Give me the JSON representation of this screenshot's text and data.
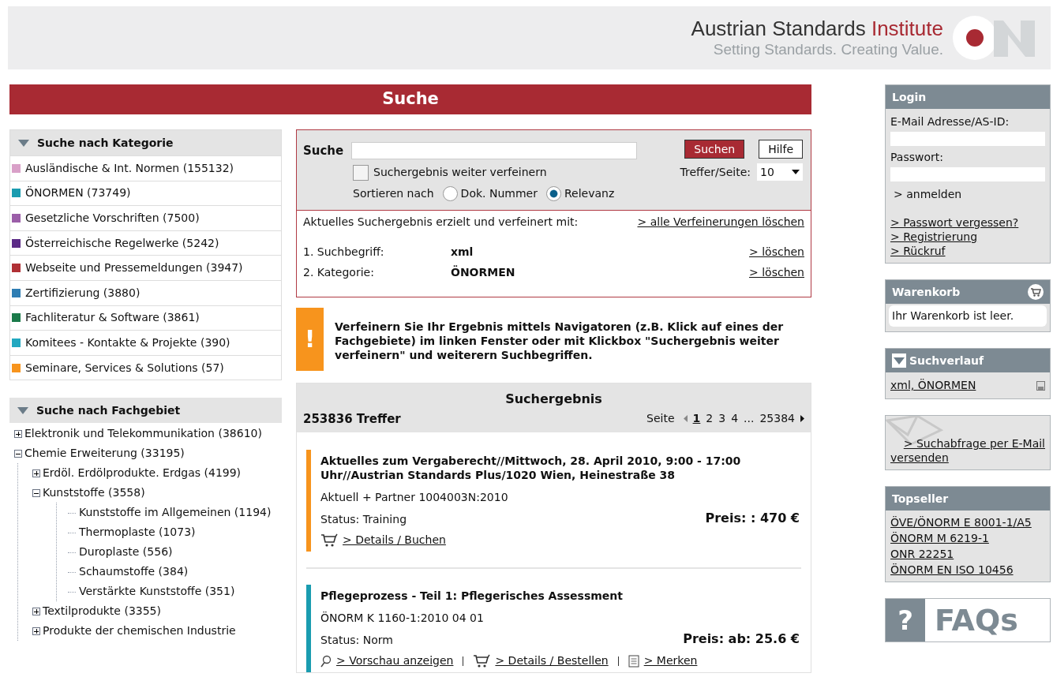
{
  "header": {
    "brand": "Austrian Standards",
    "brand_accent": "Institute",
    "tagline": "Setting Standards. Creating Value."
  },
  "page_title": "Suche",
  "categories": {
    "title": "Suche nach Kategorie",
    "items": [
      {
        "label": "Ausländische & Int. Normen (155132)",
        "color": "#d9a0c8"
      },
      {
        "label": "ÖNORMEN (73749)",
        "color": "#1a9cb0"
      },
      {
        "label": "Gesetzliche Vorschriften (7500)",
        "color": "#9b5ea8"
      },
      {
        "label": "Österreichische Regelwerke (5242)",
        "color": "#5b2a86"
      },
      {
        "label": "Webseite und Pressemeldungen (3947)",
        "color": "#b03035"
      },
      {
        "label": "Zertifizierung (3880)",
        "color": "#2e7db3"
      },
      {
        "label": "Fachliteratur & Software (3861)",
        "color": "#1a7a4a"
      },
      {
        "label": "Komitees - Kontakte & Projekte (390)",
        "color": "#22a8c0"
      },
      {
        "label": "Seminare, Services & Solutions (57)",
        "color": "#f7941d"
      }
    ]
  },
  "subjects": {
    "title": "Suche nach Fachgebiet",
    "tree": [
      {
        "label": "Elektronik und Telekommunikation (38610)",
        "kind": "branch",
        "expanded": false
      },
      {
        "label": "Chemie Erweiterung (33195)",
        "kind": "branch",
        "expanded": true,
        "children": [
          {
            "label": "Erdöl. Erdölprodukte. Erdgas (4199)",
            "kind": "branch",
            "expanded": false
          },
          {
            "label": "Kunststoffe (3558)",
            "kind": "branch",
            "expanded": true,
            "children": [
              {
                "label": "Kunststoffe im Allgemeinen (1194)",
                "kind": "leaf"
              },
              {
                "label": "Thermoplaste (1073)",
                "kind": "leaf"
              },
              {
                "label": "Duroplaste (556)",
                "kind": "leaf"
              },
              {
                "label": "Schaumstoffe (384)",
                "kind": "leaf"
              },
              {
                "label": "Verstärkte Kunststoffe (351)",
                "kind": "leaf"
              }
            ]
          },
          {
            "label": "Textilprodukte (3355)",
            "kind": "branch",
            "expanded": false
          },
          {
            "label": "Produkte der chemischen Industrie",
            "kind": "branch",
            "expanded": false
          }
        ]
      }
    ]
  },
  "search": {
    "label": "Suche",
    "search_button": "Suchen",
    "help_button": "Hilfe",
    "refine": {
      "label": "Suchergebnis weiter verfeinern",
      "checked": false
    },
    "per_page_label": "Treffer/Seite:",
    "per_page_value": "10",
    "sort_label": "Sortieren nach",
    "sort_options": [
      {
        "label": "Dok. Nummer",
        "selected": false
      },
      {
        "label": "Relevanz",
        "selected": true
      }
    ]
  },
  "refinements": {
    "intro": "Aktuelles Suchergebnis erzielt und verfeinert mit:",
    "clear_all": "> alle Verfeinerungen löschen",
    "items": [
      {
        "label": "1. Suchbegriff:",
        "value": "xml",
        "action": "> löschen"
      },
      {
        "label": "2. Kategorie:",
        "value": "ÖNORMEN",
        "action": "> löschen"
      }
    ]
  },
  "notice": {
    "mark": "!",
    "text": "Verfeinern Sie Ihr Ergebnis mittels Navigatoren (z.B. Klick auf eines der Fachgebiete) im linken Fenster oder mit Klickbox \"Suchergebnis weiter verfeinern\" und weiterern Suchbegriffen."
  },
  "results": {
    "title": "Suchergebnis",
    "count": "253836 Treffer",
    "pager_label": "Seite",
    "pages": [
      {
        "label": "1",
        "selected": true
      },
      {
        "label": "2",
        "selected": false
      },
      {
        "label": "3",
        "selected": false
      },
      {
        "label": "4",
        "selected": false
      },
      {
        "label": "...",
        "selected": false
      },
      {
        "label": "25384",
        "selected": false
      }
    ],
    "items": [
      {
        "title": "Aktuelles zum Vergaberecht//Mittwoch, 28. April 2010, 9:00 - 17:00 Uhr//Austrian Standards Plus/1020 Wien, Heinestraße 38",
        "meta": "Aktuell + Partner 1004003N:2010",
        "status": "Status: Training",
        "price": "Preis: : 470 €",
        "color": "#f7941d",
        "actions": [
          {
            "kind": "cart",
            "label": "> Details / Buchen"
          }
        ]
      },
      {
        "title": "Pflegeprozess - Teil 1: Pflegerisches Assessment",
        "meta": "ÖNORM K 1160-1:2010 04 01",
        "status": "Status: Norm",
        "price": "Preis: ab: 25.6 €",
        "color": "#1a9cb0",
        "actions": [
          {
            "kind": "preview",
            "label": "> Vorschau anzeigen"
          },
          {
            "kind": "cart",
            "label": "> Details / Bestellen"
          },
          {
            "kind": "note",
            "label": "> Merken"
          }
        ]
      }
    ]
  },
  "login": {
    "title": "Login",
    "email_label": "E-Mail Adresse/AS-ID:",
    "password_label": "Passwort:",
    "submit": "> anmelden",
    "links": [
      "> Passwort vergessen?",
      "> Registrierung",
      "> Rückruf"
    ]
  },
  "cart": {
    "title": "Warenkorb",
    "text": "Ihr Warenkorb ist leer."
  },
  "history": {
    "title": "Suchverlauf",
    "items": [
      "xml, ÖNORMEN"
    ]
  },
  "email_query": {
    "link": "> Suchabfrage per E-Mail versenden"
  },
  "topseller": {
    "title": "Topseller",
    "items": [
      "ÖVE/ÖNORM E 8001-1/A5",
      "ÖNORM M 6219-1",
      "ONR 22251",
      "ÖNORM EN ISO 10456"
    ]
  },
  "faq": {
    "mark": "?",
    "label": "FAQs"
  }
}
